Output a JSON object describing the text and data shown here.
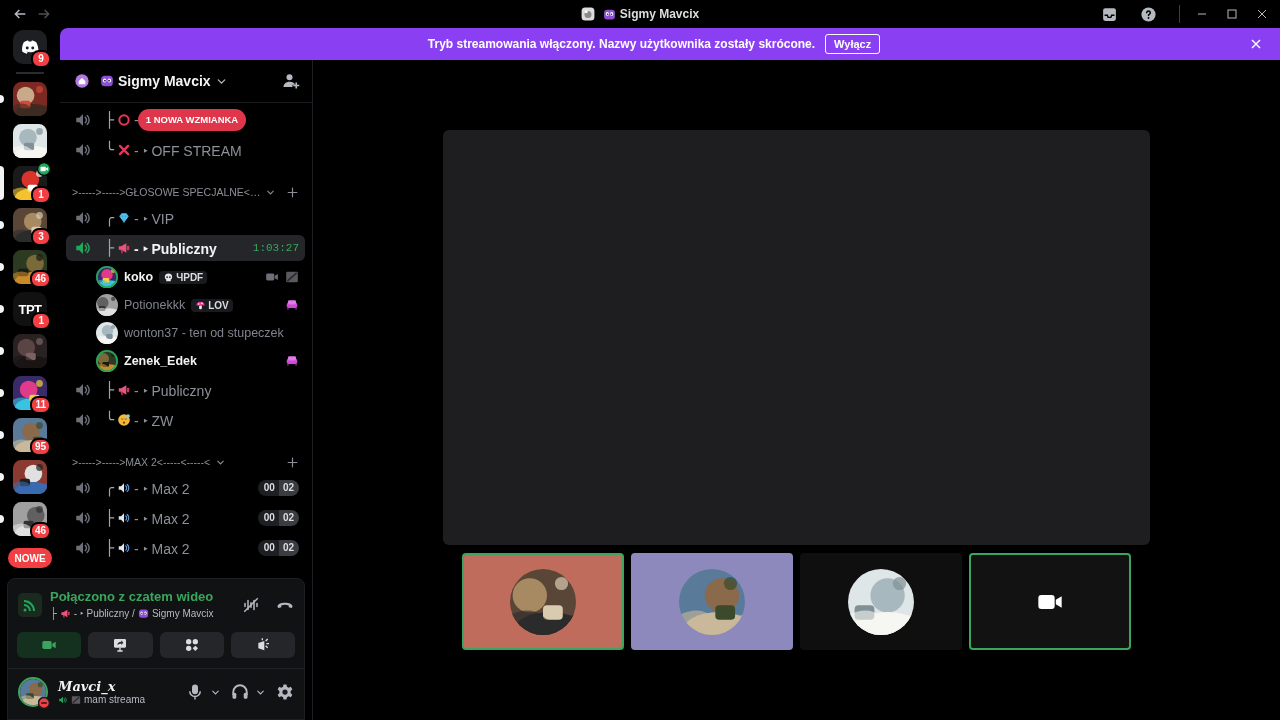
{
  "titlebar": {
    "title": "Sigmy Mavcix"
  },
  "servers": [
    {
      "kind": "home",
      "badge": "9",
      "unread": false,
      "selected": false
    },
    {
      "kind": "picture",
      "unread": true,
      "selected": false
    },
    {
      "kind": "picture",
      "unread": false,
      "selected": false
    },
    {
      "kind": "picture",
      "badge": "1",
      "selected": true,
      "video": true
    },
    {
      "kind": "picture",
      "badge": "3",
      "unread": true,
      "selected": false
    },
    {
      "kind": "picture",
      "badge": "46",
      "unread": true,
      "selected": false
    },
    {
      "kind": "text",
      "label": "TPT",
      "badge": "1",
      "unread": true,
      "selected": false
    },
    {
      "kind": "picture",
      "unread": true,
      "selected": false
    },
    {
      "kind": "picture",
      "badge": "11",
      "unread": true,
      "selected": false
    },
    {
      "kind": "picture",
      "badge": "95",
      "unread": true,
      "selected": false
    },
    {
      "kind": "picture",
      "unread": true,
      "selected": false
    },
    {
      "kind": "picture",
      "badge": "46",
      "unread": true,
      "selected": false
    }
  ],
  "new_pill": "NOWE",
  "banner": {
    "text": "Tryb streamowania włączony. Nazwy użytkownika zostały skrócone.",
    "button": "Wyłącz"
  },
  "server_header": {
    "name": "Sigmy Mavcix"
  },
  "channels": [
    {
      "kind": "voice",
      "branch": "├",
      "name": "-",
      "mention": "1 NOWA WZMIANKA",
      "selected": false
    },
    {
      "kind": "voice",
      "branch": "╰",
      "name": "- ‣ OFF STREAM",
      "selected": false
    },
    {
      "kind": "category",
      "name": ">----->----->GŁOSOWE SPECJALNE<…"
    },
    {
      "kind": "voice",
      "branch": "╭",
      "name": "- ‣ VIP",
      "selected": false
    },
    {
      "kind": "voice",
      "branch": "├",
      "name": "- ‣ Publiczny",
      "selected": true,
      "time": "1:03:27",
      "members": [
        {
          "name": "koko",
          "tag": "ЧPDF",
          "speaking": true,
          "video": true,
          "streaming": true,
          "in_activity": false
        },
        {
          "name": "Potionekkk",
          "tag": "LOV",
          "speaking": false,
          "video": false,
          "streaming": false,
          "in_activity": true
        },
        {
          "name": "wonton37 - ten od stupeczek",
          "speaking": false,
          "video": false,
          "streaming": false,
          "in_activity": false
        },
        {
          "name": "Zenek_Edek",
          "speaking": true,
          "video": false,
          "streaming": false,
          "in_activity": true
        }
      ]
    },
    {
      "kind": "voice",
      "branch": "├",
      "name": "- ‣ Publiczny",
      "selected": false
    },
    {
      "kind": "voice",
      "branch": "╰",
      "name": "- ‣ ZW",
      "selected": false
    },
    {
      "kind": "category",
      "name": ">----->----->MAX 2<-----<-----<"
    },
    {
      "kind": "voice",
      "branch": "╭",
      "name": "- ‣ Max 2",
      "selected": false,
      "limit": [
        "00",
        "02"
      ]
    },
    {
      "kind": "voice",
      "branch": "├",
      "name": "- ‣ Max 2",
      "selected": false,
      "limit": [
        "00",
        "02"
      ]
    },
    {
      "kind": "voice",
      "branch": "├",
      "name": "- ‣ Max 2",
      "selected": false,
      "limit": [
        "00",
        "02"
      ]
    }
  ],
  "voice_panel": {
    "status": "Połączono z czatem wideo",
    "branch": "├",
    "channel": "- ‣ Publiczny /",
    "server": "Sigmy Mavcix",
    "buttons": [
      {
        "kind": "camera",
        "on": true
      },
      {
        "kind": "screen",
        "on": false
      },
      {
        "kind": "activities",
        "on": false
      },
      {
        "kind": "soundboard",
        "on": false
      }
    ]
  },
  "user_panel": {
    "name": "Mavci_x",
    "status": "mam streama",
    "do_not_disturb": true
  },
  "video": {
    "tiles": [
      {
        "kind": "avatar",
        "speaking": true,
        "color": "#bf6c5c"
      },
      {
        "kind": "avatar",
        "speaking": false,
        "color": "#8e89bd"
      },
      {
        "kind": "avatar",
        "speaking": false,
        "color": "#0f0f10"
      },
      {
        "kind": "camera",
        "speaking": true,
        "color": "#121212"
      }
    ]
  }
}
